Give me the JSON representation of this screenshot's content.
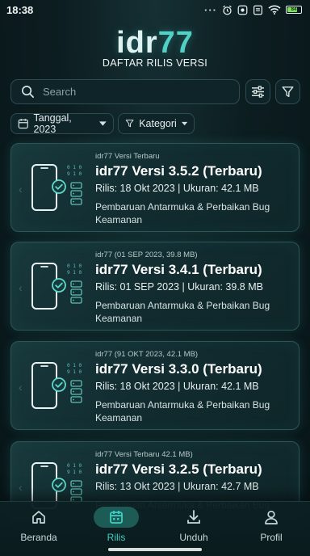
{
  "status_bar": {
    "time": "18:38",
    "dots": "···",
    "battery": "84"
  },
  "header": {
    "logo_main": "idr",
    "logo_accent": "77",
    "subtitle": "DAFTAR RILIS VERSI"
  },
  "search": {
    "placeholder": "Search",
    "value": ""
  },
  "filters": {
    "date_label": "Tanggal, 2023",
    "category_label": "Kategori"
  },
  "releases": [
    {
      "label": "idr77 Versi Terbaru",
      "title": "idr77 Versi 3.5.2 (Terbaru)",
      "meta": "Rilis: 18 Okt 2023 | Ukuran: 42.1 MB",
      "desc": "Pembaruan Antarmuka & Perbaikan Bug Keamanan"
    },
    {
      "label": "idr77 (01 SEP 2023, 39.8 MB)",
      "title": "idr77 Versi 3.4.1 (Terbaru)",
      "meta": "Rilis: 01 SEP 2023 | Ukuran: 39.8 MB",
      "desc": "Pembaruan Antarmuka & Perbaikan Bug Keamanan"
    },
    {
      "label": "idr77 (91 OKT 2023, 42.1 MB)",
      "title": "idr77 Versi 3.3.0 (Terbaru)",
      "meta": "Rilis: 18 Okt 2023 | Ukuran: 42.1 MB",
      "desc": "Pembaruan Antarmuka & Perbaikan Bug Keamanan"
    },
    {
      "label": "idr77 Versi Terbaru 42.1 MB)",
      "title": "idr77 Versi 3.2.5 (Terbaru)",
      "meta": "Rilis: 13 Okt 2023 | Ukuran: 42.7 MB",
      "desc": "Pembaruan Antarmuka & Perbaikan Bug Keamanan"
    }
  ],
  "bottom_nav": {
    "items": [
      {
        "label": "Beranda",
        "icon": "home-icon"
      },
      {
        "label": "Rilis",
        "icon": "calendar-icon",
        "active": true
      },
      {
        "label": "Unduh",
        "icon": "download-icon"
      },
      {
        "label": "Profil",
        "icon": "user-icon"
      }
    ]
  },
  "colors": {
    "accent": "#4fd1c5",
    "background": "#0c1d20",
    "card_border": "#2e5458",
    "active_nav": "#3fd0c2"
  }
}
